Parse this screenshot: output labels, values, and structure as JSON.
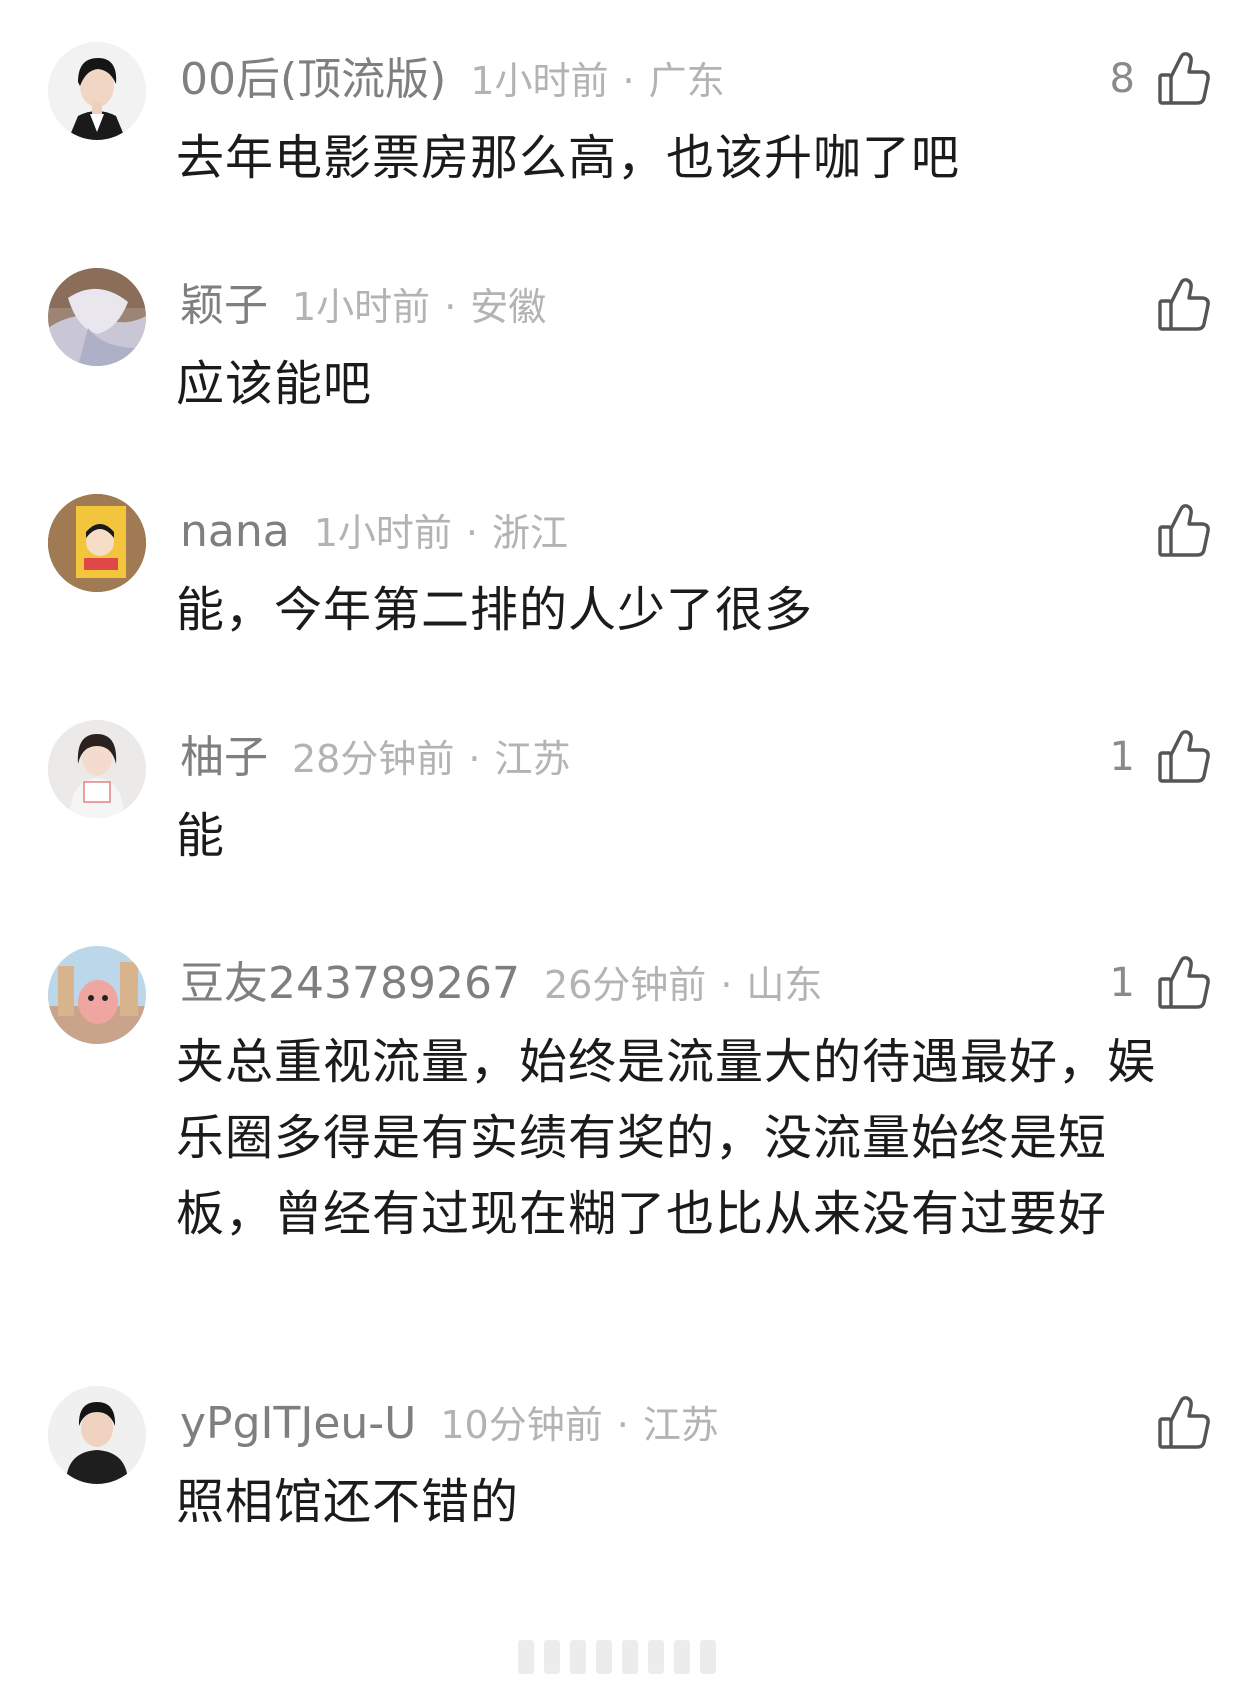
{
  "comments": [
    {
      "username": "00后(顶流版)",
      "time": "1小时前",
      "location": "广东",
      "separator": "·",
      "text": "去年电影票房那么高，也该升咖了吧",
      "likes": "8"
    },
    {
      "username": "颖子",
      "time": "1小时前",
      "location": "安徽",
      "separator": "·",
      "text": "应该能吧",
      "likes": ""
    },
    {
      "username": "nana",
      "time": "1小时前",
      "location": "浙江",
      "separator": "·",
      "text": "能，今年第二排的人少了很多",
      "likes": ""
    },
    {
      "username": "柚子",
      "time": "28分钟前",
      "location": "江苏",
      "separator": "·",
      "text": "能",
      "likes": "1"
    },
    {
      "username": "豆友243789267",
      "time": "26分钟前",
      "location": "山东",
      "separator": "·",
      "text": "夹总重视流量，始终是流量大的待遇最好，娱乐圈多得是有实绩有奖的，没流量始终是短板，曾经有过现在糊了也比从来没有过要好",
      "likes": "1"
    },
    {
      "username": "yPgITJeu-U",
      "time": "10分钟前",
      "location": "江苏",
      "separator": "·",
      "text": "照相馆还不错的",
      "likes": ""
    }
  ],
  "icons": {
    "like": "thumbs-up-icon"
  },
  "colors": {
    "username": "#7f7f7f",
    "meta": "#b3b3b3",
    "body": "#1b1b1b",
    "icon": "#555555"
  }
}
